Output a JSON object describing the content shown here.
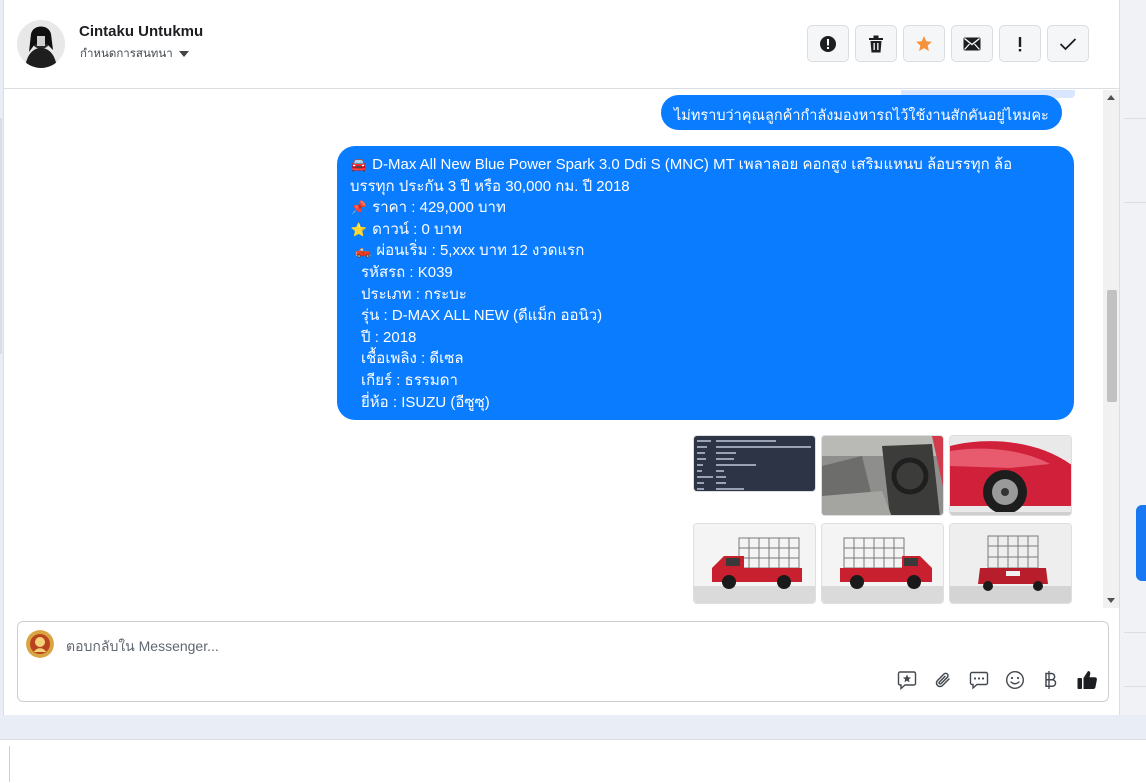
{
  "header": {
    "contact_name": "Cintaku Untukmu",
    "assign_label": "กำหนดการสนทนา",
    "actions": [
      {
        "name": "report-icon"
      },
      {
        "name": "trash-icon"
      },
      {
        "name": "star-icon",
        "color": "#f7923b"
      },
      {
        "name": "mail-icon"
      },
      {
        "name": "important-icon"
      },
      {
        "name": "check-icon"
      }
    ]
  },
  "chat": {
    "question": "ไม่ทราบว่าคุณลูกค้ากำลังมองหารถไว้ใช้งานสักคันอยู่ไหมคะ",
    "listing": {
      "title_line1": "D-Max All New Blue Power Spark 3.0 Ddi S (MNC) MT เพลาลอย คอกสูง เสริมแหนบ ล้อบรรทุก ล้อ",
      "title_line2": "บรรทุก ประกัน 3 ปี หรือ 30,000 กม. ปี 2018",
      "price": "ราคา : 429,000 บาท",
      "down": "ดาวน์ : 0 บาท",
      "installment": "ผ่อนเริ่ม : 5,xxx บาท 12 งวดแรก",
      "code": "รหัสรถ : K039",
      "type": "ประเภท : กระบะ",
      "model": "รุ่น : D-MAX ALL NEW (ดีแม็ก ออนิว)",
      "year": "ปี : 2018",
      "fuel": "เชื้อเพลิง : ดีเซล",
      "gear": "เกียร์ : ธรรมดา",
      "brand": "ยี่ห้อ : ISUZU (อีซูซุ)"
    },
    "photos": [
      "spec-sheet",
      "car-interior",
      "front-wheel",
      "truck-side-left",
      "truck-side-right",
      "truck-rear"
    ]
  },
  "composer": {
    "placeholder": "ตอบกลับใน Messenger...",
    "tools": [
      "saved-reply-icon",
      "attachment-icon",
      "chat-bubble-icon",
      "emoji-icon",
      "baht-icon",
      "like-icon"
    ]
  },
  "colors": {
    "bubble": "#0a7cff",
    "accent": "#1877f2",
    "star": "#f7923b"
  }
}
